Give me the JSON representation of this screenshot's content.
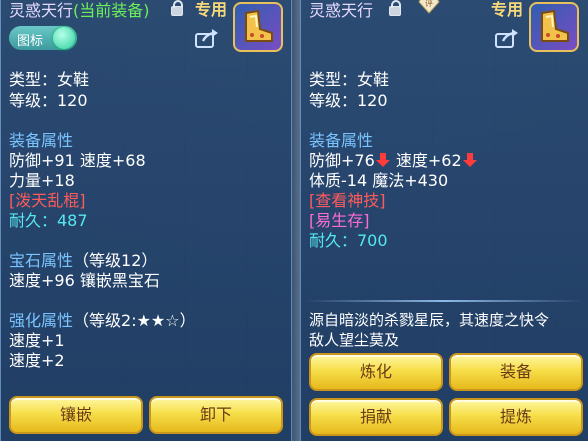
{
  "left": {
    "title_name": "灵惑天行",
    "title_current": "(当前装备)",
    "exclusive": "专用",
    "toggle_label": "图标",
    "type": "类型：女鞋",
    "level": "等级：120",
    "attr_header": "装备属性",
    "attr_line1": "防御+91 速度+68",
    "attr_line2": "力量+18",
    "special_skill": "[泼天乱棍]",
    "durability": "耐久：487",
    "gem_header": "宝石属性",
    "gem_level": "（等级12）",
    "gem_line": "速度+96 镶嵌黑宝石",
    "enhance_header": "强化属性",
    "enhance_level": "（等级2:★★☆）",
    "enhance_line1": "速度+1",
    "enhance_line2": "速度+2",
    "buttons": [
      "镶嵌",
      "卸下"
    ]
  },
  "right": {
    "title_name": "灵惑天行",
    "gem_badge": "评",
    "exclusive": "专用",
    "type": "类型：女鞋",
    "level": "等级：120",
    "attr_header": "装备属性",
    "attr_def": "防御+76",
    "attr_spd": "速度+62",
    "attr_line2": "体质-14 魔法+430",
    "skill": "[查看神技]",
    "special_effect": "[易生存]",
    "durability": "耐久：700",
    "description_line1": "源自暗淡的杀戮星辰，其速度之快令",
    "description_line2": "敌人望尘莫及",
    "buttons": [
      "炼化",
      "装备",
      "捐献",
      "提炼"
    ]
  },
  "colors": {
    "attr_header": "#7ac4ff",
    "current_equipped": "#6cf05a",
    "special_skill": "#ff5b5b",
    "durability": "#55e8f0",
    "special_effect": "#ff6cd6",
    "button_gold": "#f6df4a"
  },
  "icons": [
    "lock-icon",
    "boot-item-icon",
    "share-icon",
    "gem-badge-icon",
    "down-arrow-icon"
  ]
}
